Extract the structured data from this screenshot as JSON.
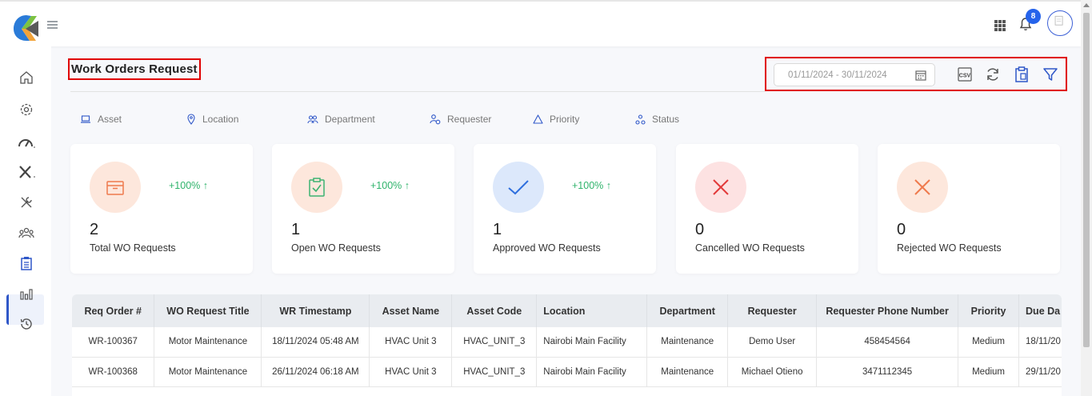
{
  "header": {
    "notification_count": "8",
    "icons": [
      "apps-grid-icon",
      "bell-icon",
      "user-avatar-icon",
      "hamburger-icon"
    ]
  },
  "sidebar": {
    "items": [
      {
        "name": "home-icon"
      },
      {
        "name": "settings-icon"
      },
      {
        "name": "speedometer-icon"
      },
      {
        "name": "tools-icon"
      },
      {
        "name": "wrench-screwdriver-icon"
      },
      {
        "name": "users-icon"
      },
      {
        "name": "clipboard-icon",
        "active": true
      },
      {
        "name": "bar-chart-icon"
      },
      {
        "name": "history-icon"
      }
    ]
  },
  "page": {
    "title": "Work Orders Request"
  },
  "toolbar": {
    "date_range": "01/11/2024 - 30/11/2024",
    "csv_label": "CSV"
  },
  "filters": [
    "Asset",
    "Location",
    "Department",
    "Requester",
    "Priority",
    "Status"
  ],
  "cards": [
    {
      "count": "2",
      "label": "Total WO Requests",
      "trend": "+100% ↑",
      "icon": "box-icon",
      "bg": "#fde7dc",
      "fg": "#ef7a4d"
    },
    {
      "count": "1",
      "label": "Open WO Requests",
      "trend": "+100% ↑",
      "icon": "clipboard-check-icon",
      "bg": "#fde7dc",
      "fg": "#3cb371"
    },
    {
      "count": "1",
      "label": "Approved WO Requests",
      "trend": "+100% ↑",
      "icon": "check-icon",
      "bg": "#dce8fb",
      "fg": "#2f6fde"
    },
    {
      "count": "0",
      "label": "Cancelled WO Requests",
      "trend": "",
      "icon": "x-icon",
      "bg": "#fde2e2",
      "fg": "#e23b3b"
    },
    {
      "count": "0",
      "label": "Rejected WO Requests",
      "trend": "",
      "icon": "x-icon",
      "bg": "#fde7dc",
      "fg": "#ef7a4d"
    }
  ],
  "table": {
    "columns": [
      "Req Order #",
      "WO Request Title",
      "WR Timestamp",
      "Asset Name",
      "Asset Code",
      "Location",
      "Department",
      "Requester",
      "Requester Phone Number",
      "Priority",
      "Due Da"
    ],
    "rows": [
      [
        "WR-100367",
        "Motor Maintenance",
        "18/11/2024 05:48 AM",
        "HVAC Unit 3",
        "HVAC_UNIT_3",
        "Nairobi Main Facility",
        "Maintenance",
        "Demo User",
        "458454564",
        "Medium",
        "18/11/20"
      ],
      [
        "WR-100368",
        "Motor Maintenance",
        "26/11/2024 06:18 AM",
        "HVAC Unit 3",
        "HVAC_UNIT_3",
        "Nairobi Main Facility",
        "Maintenance",
        "Michael Otieno",
        "3471112345",
        "Medium",
        "29/11/20"
      ]
    ]
  },
  "colors": {
    "accent": "#2563eb",
    "highlight_border": "#e00000",
    "trend_up": "#2fb36b"
  }
}
